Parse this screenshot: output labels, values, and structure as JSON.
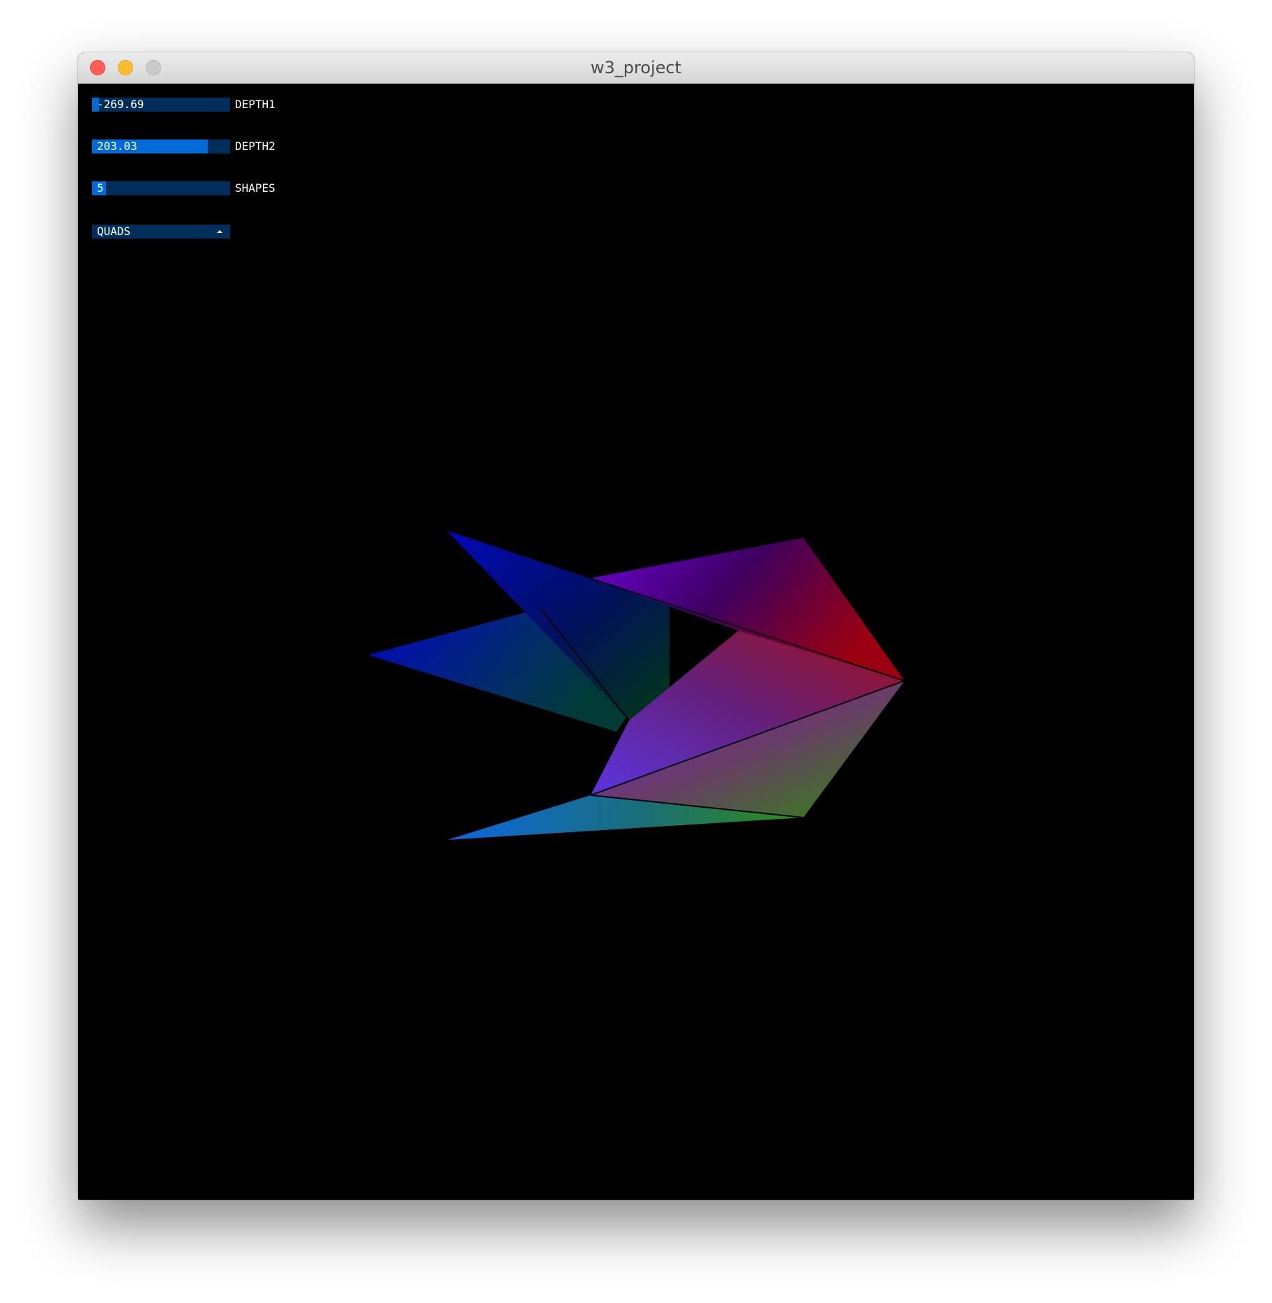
{
  "window": {
    "title": "w3_project"
  },
  "controls": {
    "depth1": {
      "label": "DEPTH1",
      "value": "-269.69",
      "fraction": 0.05
    },
    "depth2": {
      "label": "DEPTH2",
      "value": "203.03",
      "fraction": 0.84
    },
    "shapes": {
      "label": "SHAPES",
      "value": "5",
      "fraction": 0.1
    },
    "mode": {
      "selected": "QUADS"
    }
  },
  "colors": {
    "background": "#000000",
    "control_bg": "#002d5a",
    "control_fill": "#006bd6"
  }
}
